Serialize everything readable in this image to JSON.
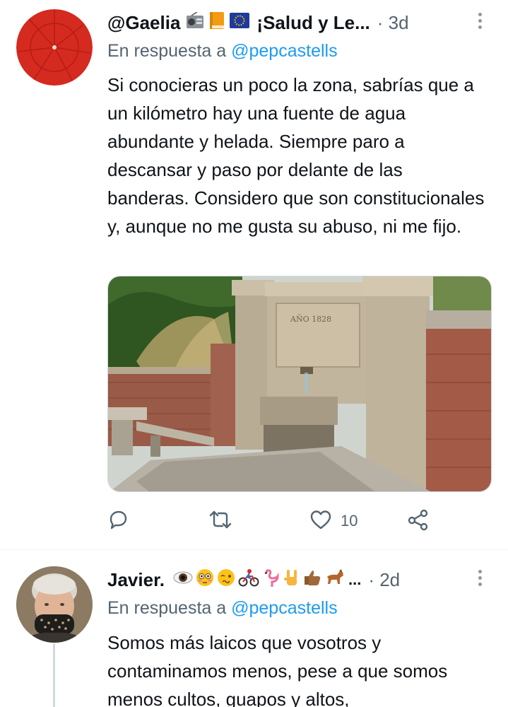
{
  "tweets": [
    {
      "display_name": "@Gaelia",
      "name_suffix": "¡Salud y Le...",
      "time": "· 3d",
      "reply_prefix": "En respuesta a",
      "reply_handle": "@pepcastells",
      "text": "Si conocieras un poco la zona, sabrías que a un kilómetro hay una fuente de agua abundante y helada. Siempre paro a descansar y paso por delante de las banderas. Considero que son constitucionales y, aunque no me gusta su abuso, ni me fijo.",
      "media_inscription": "AÑO 1828",
      "actions": {
        "reply_count": "",
        "retweet_count": "",
        "like_count": "10"
      }
    },
    {
      "display_name": "Javier.",
      "name_suffix": "...",
      "time": "· 2d",
      "reply_prefix": "En respuesta a",
      "reply_handle": "@pepcastells",
      "text": "Somos más laicos que vosotros y contaminamos menos, pese a que somos menos cultos, guapos y altos,"
    }
  ],
  "icons": {
    "first_name_emojis": [
      "radio-icon",
      "orange-book-icon",
      "eu-flag-icon"
    ],
    "second_name_emojis": [
      "eye-icon",
      "flushed-face-icon",
      "woozy-face-icon",
      "cyclist-icon",
      "flamingo-icon",
      "rock-hand-icon",
      "thumbs-up-icon",
      "horse-icon"
    ]
  },
  "colors": {
    "link_blue": "#1d9bf0",
    "secondary_text": "#536471",
    "primary_text": "#0f1419"
  }
}
